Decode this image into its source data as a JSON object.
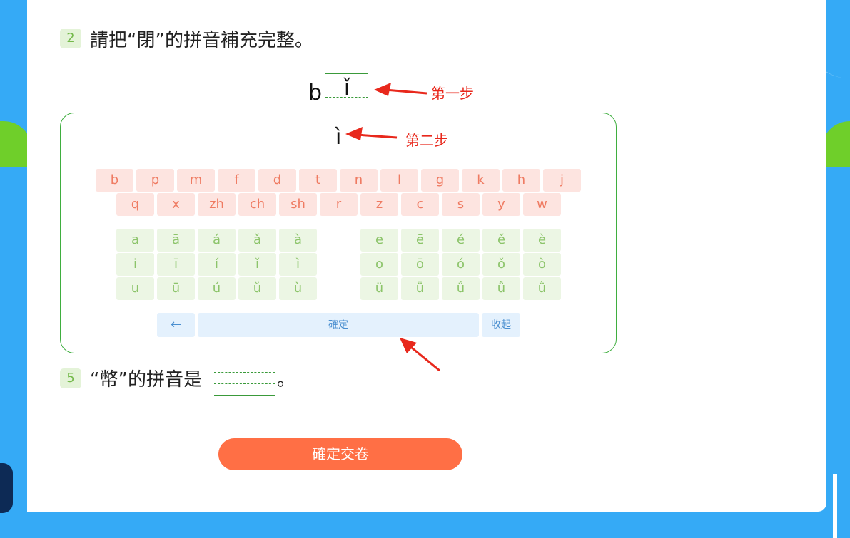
{
  "question2": {
    "number": "2",
    "text": "請把“閉”的拼音補充完整。"
  },
  "pinyin": {
    "initial": "b",
    "final": "ǐ"
  },
  "annotations": {
    "step1": "第一步",
    "step2": "第二步"
  },
  "keyboard": {
    "preview": "ì",
    "consonants_row1": [
      "b",
      "p",
      "m",
      "f",
      "d",
      "t",
      "n",
      "l",
      "g",
      "k",
      "h",
      "j"
    ],
    "consonants_row2": [
      "q",
      "x",
      "zh",
      "ch",
      "sh",
      "r",
      "z",
      "c",
      "s",
      "y",
      "w"
    ],
    "vowels_left": [
      [
        "a",
        "ā",
        "á",
        "ǎ",
        "à"
      ],
      [
        "i",
        "ī",
        "í",
        "ǐ",
        "ì"
      ],
      [
        "u",
        "ū",
        "ú",
        "ǔ",
        "ù"
      ]
    ],
    "vowels_right": [
      [
        "e",
        "ē",
        "é",
        "ě",
        "è"
      ],
      [
        "o",
        "ō",
        "ó",
        "ǒ",
        "ò"
      ],
      [
        "ü",
        "ǖ",
        "ǘ",
        "ǚ",
        "ǜ"
      ]
    ],
    "backspace_label": "←",
    "confirm_label": "確定",
    "collapse_label": "收起"
  },
  "question5": {
    "number": "5",
    "text": "“幣”的拼音是",
    "suffix": "。"
  },
  "submit_label": "確定交卷",
  "colors": {
    "accent": "#ff6f45",
    "background": "#35aaf6",
    "consonant_text": "#ef7b62",
    "vowel_text": "#8cc46a",
    "annotation": "#e8281c"
  }
}
